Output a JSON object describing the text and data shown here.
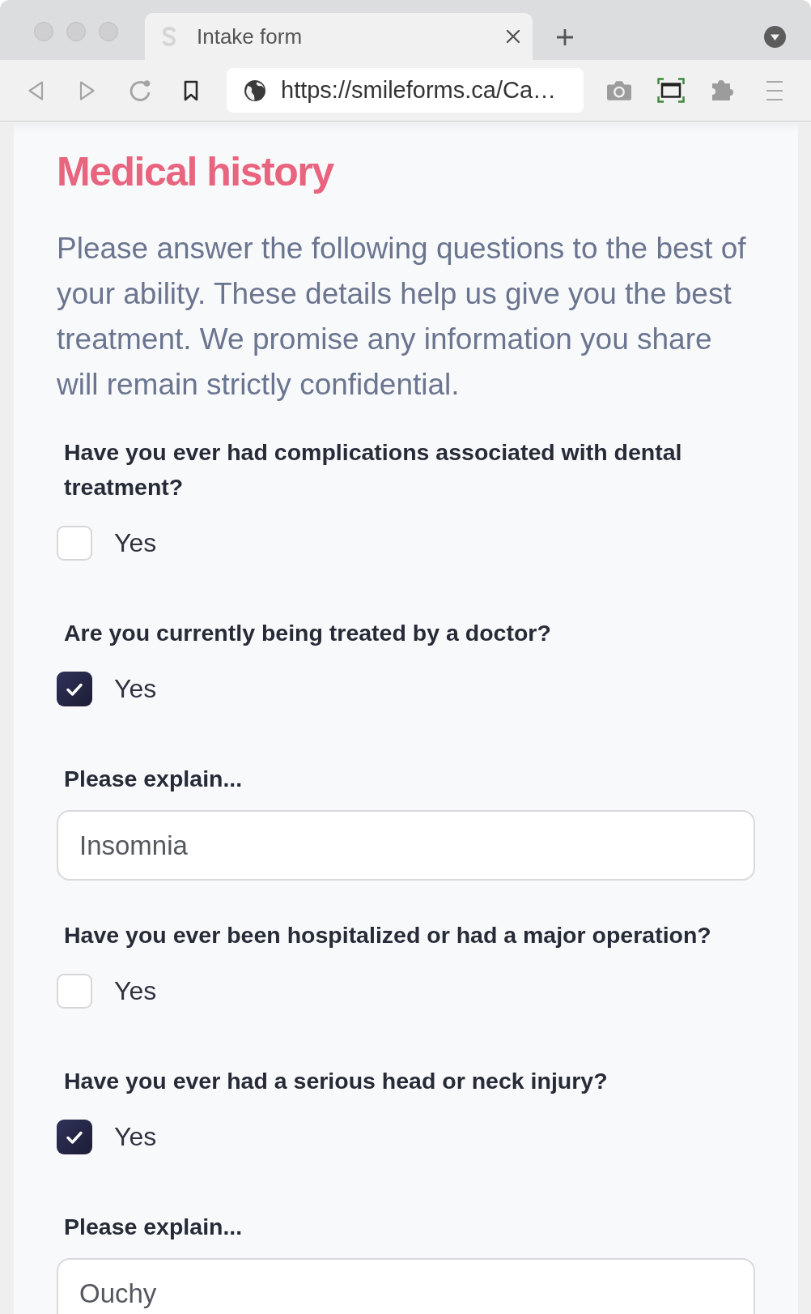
{
  "browser": {
    "tabs": [
      {
        "title": "Intake form",
        "selected": true
      }
    ],
    "address_bar": {
      "url": "https://smileforms.ca/Ca…"
    }
  },
  "page": {
    "title": "Medical history",
    "intro": "Please answer the following questions to the best of your ability. These details help us give you the best treatment. We promise any information you share will remain strictly confidential.",
    "fields": [
      {
        "kind": "checkbox",
        "label": "Have you ever had complications associated with dental treatment?",
        "option": "Yes",
        "checked": false
      },
      {
        "kind": "checkbox",
        "label": "Are you currently being treated by a doctor?",
        "option": "Yes",
        "checked": true
      },
      {
        "kind": "text",
        "label": "Please explain...",
        "value": "Insomnia"
      },
      {
        "kind": "checkbox",
        "label": "Have you ever been hospitalized or had a major operation?",
        "option": "Yes",
        "checked": false
      },
      {
        "kind": "checkbox",
        "label": "Have you ever had a serious head or neck injury?",
        "option": "Yes",
        "checked": true
      },
      {
        "kind": "text",
        "label": "Please explain...",
        "value": "Ouchy"
      }
    ]
  }
}
